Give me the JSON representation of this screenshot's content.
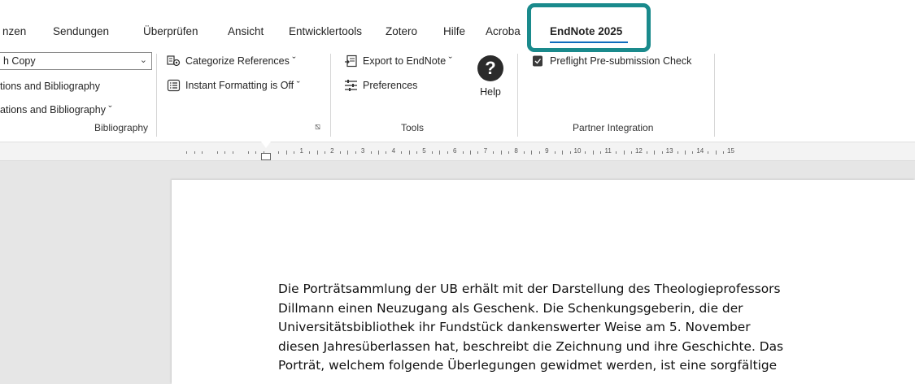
{
  "tabs": [
    {
      "label": "nzen",
      "active": false
    },
    {
      "label": "Sendungen",
      "active": false
    },
    {
      "label": "Überprüfen",
      "active": false
    },
    {
      "label": "Ansicht",
      "active": false
    },
    {
      "label": "Entwicklertools",
      "active": false
    },
    {
      "label": "Zotero",
      "active": false
    },
    {
      "label": "Hilfe",
      "active": false
    },
    {
      "label": "Acroba",
      "active": false
    },
    {
      "label": "EndNote 2025",
      "active": true
    }
  ],
  "bibliography": {
    "style_value": "h Copy",
    "item1": "tions and Bibliography",
    "item2": "ations and Bibliography ˇ",
    "group_label": "Bibliography"
  },
  "formatting": {
    "categorize": "Categorize References ˇ",
    "instant": "Instant Formatting is Off ˇ"
  },
  "tools": {
    "export": "Export to EndNote ˇ",
    "preferences": "Preferences",
    "help": "Help",
    "group_label": "Tools"
  },
  "partner": {
    "preflight": "Preflight Pre-submission Check",
    "group_label": "Partner Integration"
  },
  "ruler": {
    "numbers": [
      "1",
      "2",
      "3",
      "4",
      "5",
      "6",
      "7",
      "8",
      "9",
      "10",
      "11",
      "12",
      "13",
      "14",
      "15"
    ]
  },
  "document": {
    "lines": [
      "Die Porträtsammlung der UB erhält mit der Darstellung des Theologieprofessors",
      "Dillmann einen Neuzugang als Geschenk. Die Schenkungsgeberin, die der",
      "Universitätsbibliothek ihr Fundstück dankenswerter Weise am 5. November",
      "diesen Jahresüberlassen hat, beschreibt die Zeichnung und ihre Geschichte. Das",
      "Porträt, welchem folgende Überlegungen gewidmet werden, ist eine sorgfältige"
    ]
  },
  "colors": {
    "highlight": "#1a8a8c",
    "active_underline": "#0f6cbd"
  }
}
